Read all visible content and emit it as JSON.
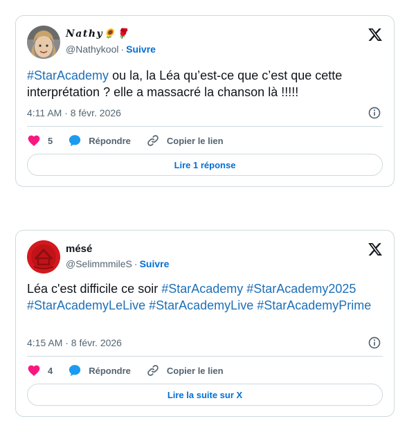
{
  "tweets": [
    {
      "name": "𝑵𝒂𝒕𝒉𝒚🌻🌹",
      "handle": "@Nathykool",
      "separator": "·",
      "follow_label": "Suivre",
      "text_parts": [
        {
          "type": "hashtag",
          "text": "#StarAcademy"
        },
        {
          "type": "text",
          "text": " ou la, la Léa qu’est-ce que c’est que cette interprétation ? elle a massacré la chanson là !!!!!"
        }
      ],
      "timestamp": "4:11 AM · 8 févr. 2026",
      "like_count": "5",
      "reply_label": "Répondre",
      "copy_label": "Copier le lien",
      "pill_label": "Lire 1 réponse"
    },
    {
      "name": "mésé",
      "handle": "@SelimmmileS",
      "separator": "·",
      "follow_label": "Suivre",
      "text_parts": [
        {
          "type": "text",
          "text": "Léa c'est difficile ce soir "
        },
        {
          "type": "hashtag",
          "text": "#StarAcademy"
        },
        {
          "type": "text",
          "text": " "
        },
        {
          "type": "hashtag",
          "text": "#StarAcademy2025"
        },
        {
          "type": "text",
          "text": " "
        },
        {
          "type": "hashtag",
          "text": "#StarAcademyLeLive"
        },
        {
          "type": "text",
          "text": " "
        },
        {
          "type": "hashtag",
          "text": "#StarAcademyLive"
        },
        {
          "type": "text",
          "text": " "
        },
        {
          "type": "hashtag",
          "text": "#StarAcademyPrime"
        }
      ],
      "timestamp": "4:15 AM · 8 févr. 2026",
      "like_count": "4",
      "reply_label": "Répondre",
      "copy_label": "Copier le lien",
      "pill_label": "Lire la suite sur X"
    }
  ],
  "colors": {
    "link_blue": "#006fd6",
    "hashtag_blue": "#1d6fb8",
    "like_pink": "#f91880",
    "reply_blue": "#1d9bf0",
    "muted": "#536471",
    "border": "#cfd9de"
  },
  "icons": {
    "platform": "x-logo-icon",
    "info": "info-icon",
    "like": "heart-icon",
    "reply": "speech-bubble-icon",
    "copy": "link-icon"
  }
}
